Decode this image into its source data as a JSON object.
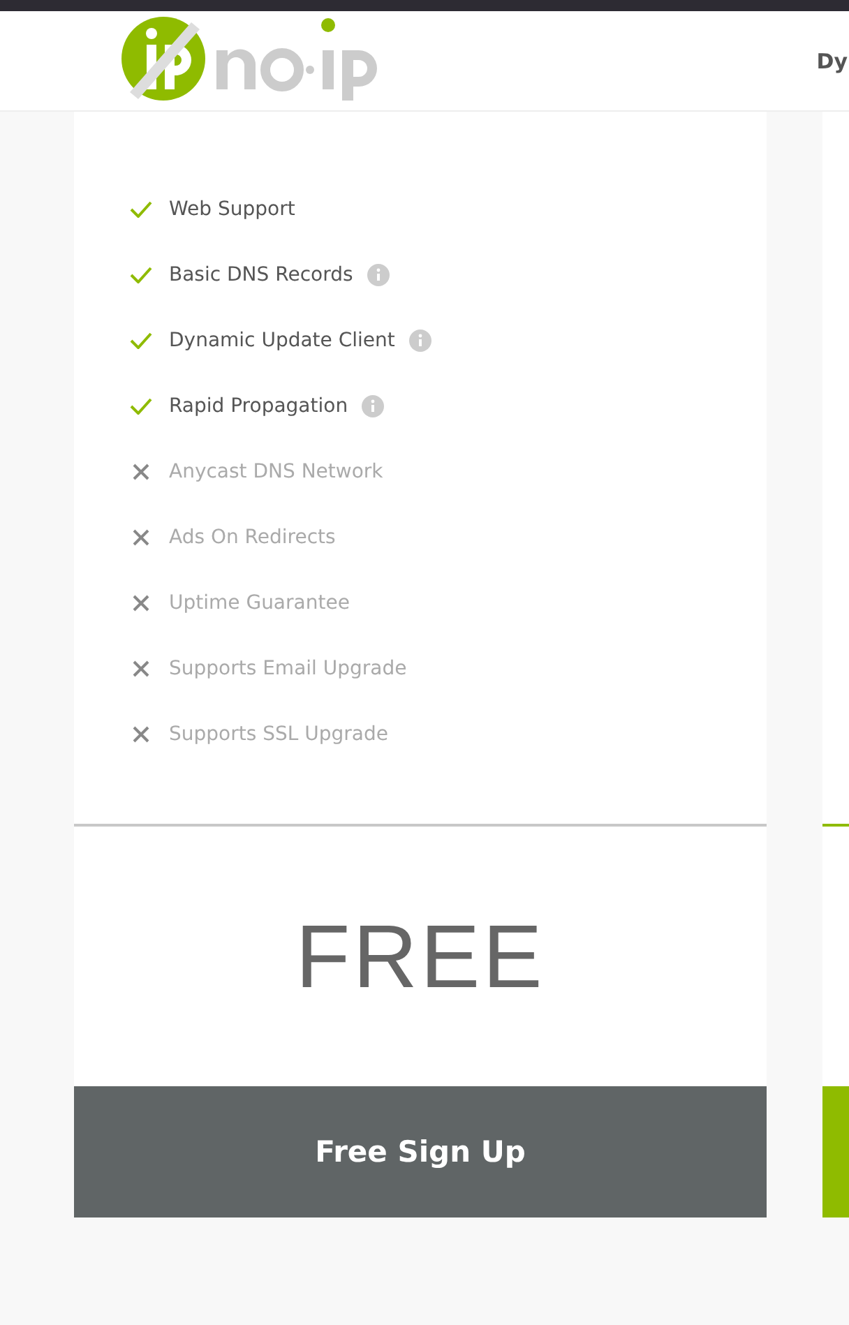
{
  "header": {
    "nav_items": [
      "Dy"
    ]
  },
  "plans": [
    {
      "kind": "free",
      "features": [
        {
          "label": "Web Support",
          "included": true,
          "info": false
        },
        {
          "label": "Basic DNS Records",
          "included": true,
          "info": true
        },
        {
          "label": "Dynamic Update Client",
          "included": true,
          "info": true
        },
        {
          "label": "Rapid Propagation",
          "included": true,
          "info": true
        },
        {
          "label": "Anycast DNS Network",
          "included": false,
          "info": false
        },
        {
          "label": "Ads On Redirects",
          "included": false,
          "info": false
        },
        {
          "label": "Uptime Guarantee",
          "included": false,
          "info": false
        },
        {
          "label": "Supports Email Upgrade",
          "included": false,
          "info": false
        },
        {
          "label": "Supports SSL Upgrade",
          "included": false,
          "info": false
        }
      ],
      "price": "FREE",
      "button": "Free Sign Up"
    },
    {
      "kind": "paid"
    }
  ]
}
